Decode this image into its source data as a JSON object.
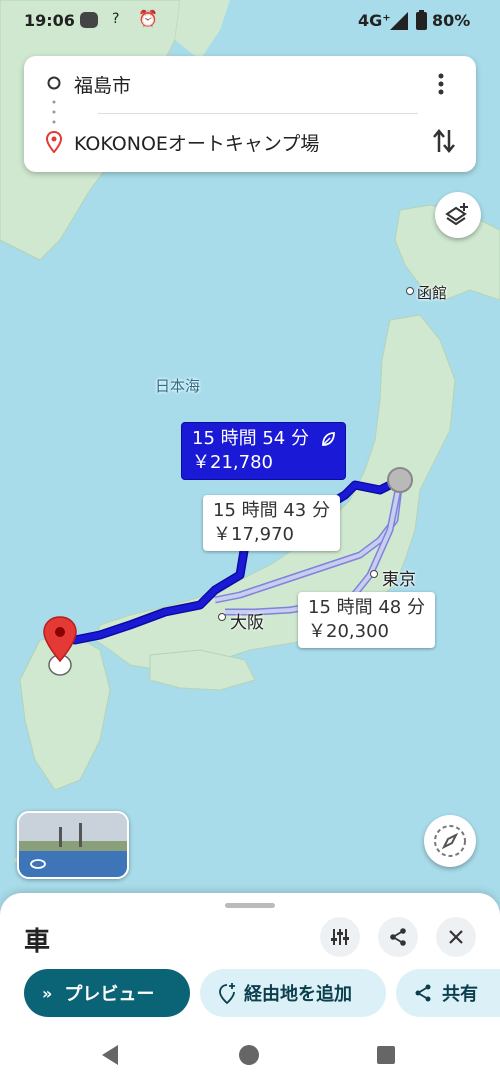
{
  "status_bar": {
    "time": "19:06",
    "network": "4G⁺",
    "battery": "80%",
    "icons": [
      "line-icon",
      "wifi-question-icon",
      "alarm-icon",
      "signal-icon",
      "battery-icon"
    ]
  },
  "search": {
    "origin": "福島市",
    "destination": "KOKONOEオートキャンプ場"
  },
  "map": {
    "sea_label": "日本海",
    "cities": [
      "函館",
      "東京",
      "大阪"
    ]
  },
  "routes": [
    {
      "duration": "15 時間 54 分",
      "fare": "￥21,780",
      "selected": true,
      "eco_icon": "leaf-icon"
    },
    {
      "duration": "15 時間 43 分",
      "fare": "￥17,970",
      "selected": false
    },
    {
      "duration": "15 時間 48 分",
      "fare": "￥20,300",
      "selected": false
    }
  ],
  "sheet": {
    "mode": "車",
    "preview_label": "プレビュー",
    "add_stop_label": "経由地を追加",
    "share_label": "共有"
  },
  "colors": {
    "route_selected": "#1a1ad6",
    "route_alt": "#b7bde8",
    "primary_button": "#0b6476",
    "secondary_button": "#dcf1f7",
    "destination_pin": "#e53935",
    "sea": "#a8dcea",
    "land": "#cfe8cf"
  }
}
